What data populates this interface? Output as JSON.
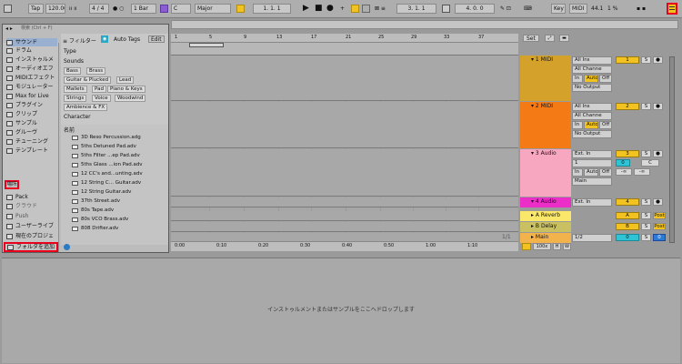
{
  "toolbar": {
    "tap": "Tap",
    "tempo": "120.00",
    "signature": "4 / 4",
    "quantize": "1 Bar",
    "key": "C",
    "scale": "Major",
    "position": "1.  1.  1",
    "loop_start": "3.  1.  1",
    "loop_length": "4.  0.  0",
    "key_label": "Key",
    "midi_label": "MIDI",
    "cpu": "44.1",
    "cpu_pct": "1 %",
    "colors": {
      "yellow": "#f2c320",
      "red": "#e8001c"
    }
  },
  "browser": {
    "search_placeholder": "検索 (Ctrl + F)",
    "filter_label": "フィルター",
    "auto_tags": "Auto Tags",
    "edit": "Edit",
    "categories": [
      "サウンド",
      "ドラム",
      "インストゥルメ",
      "オーディオエフ",
      "MIDIエフェクト",
      "モジュレーター",
      "Max for Live",
      "プラグイン",
      "クリップ",
      "サンプル",
      "グルーヴ",
      "チューニング",
      "テンプレート"
    ],
    "places_header": "場所",
    "places": [
      "Pack",
      "クラウド",
      "Push",
      "ユーザーライブ",
      "現在のプロジェ"
    ],
    "add_folder": "フォルダを追加",
    "type_label": "Type",
    "sounds_label": "Sounds",
    "tags": [
      [
        "Bass",
        "Brass"
      ],
      [
        "Guitar & Plucked",
        "Lead"
      ],
      [
        "Mallets",
        "Pad",
        "Piano & Keys"
      ],
      [
        "Strings",
        "Voice",
        "Woodwind"
      ],
      [
        "Ambience & FX"
      ]
    ],
    "character_label": "Character",
    "name_header": "名前",
    "files": [
      "3D Reso Percussion.adg",
      "5ths Detuned Pad.adv",
      "5ths Filter ...ep Pad.adv",
      "5ths Glass ...ion Pad.adv",
      "12 CC's and...unting.adv",
      "12 String C... Guitar.adv",
      "12 String Guitar.adv",
      "37th Street.adv",
      "80s Tape.adv",
      "80s VCO Brass.adv",
      "808 Drifter.adv"
    ]
  },
  "arrangement": {
    "bars": [
      "1",
      "5",
      "9",
      "13",
      "17",
      "21",
      "25",
      "29",
      "33",
      "37"
    ],
    "times": [
      "0:00",
      "0:10",
      "0:20",
      "0:30",
      "0:40",
      "0:50",
      "1:00",
      "1:10"
    ],
    "set_label": "Set",
    "page": "1/1",
    "zoom": "100x",
    "h_btn": "H",
    "w_btn": "W"
  },
  "tracks": [
    {
      "name": "1 MIDI",
      "color": "#d4a12a",
      "in": "All Ins",
      "ch": "All Channe",
      "out": "No Output",
      "num": "1",
      "mon": [
        "In",
        "Auto",
        "Off"
      ]
    },
    {
      "name": "2 MIDI",
      "color": "#f47a16",
      "in": "All Ins",
      "ch": "All Channe",
      "out": "No Output",
      "num": "2",
      "mon": [
        "In",
        "Auto",
        "Off"
      ]
    },
    {
      "name": "3 Audio",
      "color": "#f7a8c0",
      "in": "Ext. In",
      "ch": "1",
      "out": "Main",
      "num": "3",
      "mon": [
        "In",
        "Auto",
        "Off"
      ],
      "vol": "0",
      "pan": "C",
      "sends": [
        "-∞",
        "-∞"
      ]
    },
    {
      "name": "4 Audio",
      "color": "#ea2ec7",
      "in": "Ext. In",
      "num": "4"
    },
    {
      "name": "A Reverb",
      "color": "#fbe86a",
      "num": "A",
      "post": "Post"
    },
    {
      "name": "B Delay",
      "color": "#c9c062",
      "num": "B",
      "post": "Post"
    },
    {
      "name": "Main",
      "color": "#f2b24c",
      "out": "1/2",
      "num": "0",
      "vol": "0"
    }
  ],
  "detail": {
    "drop_text": "インストゥルメントまたはサンプルをここへドロップします"
  }
}
